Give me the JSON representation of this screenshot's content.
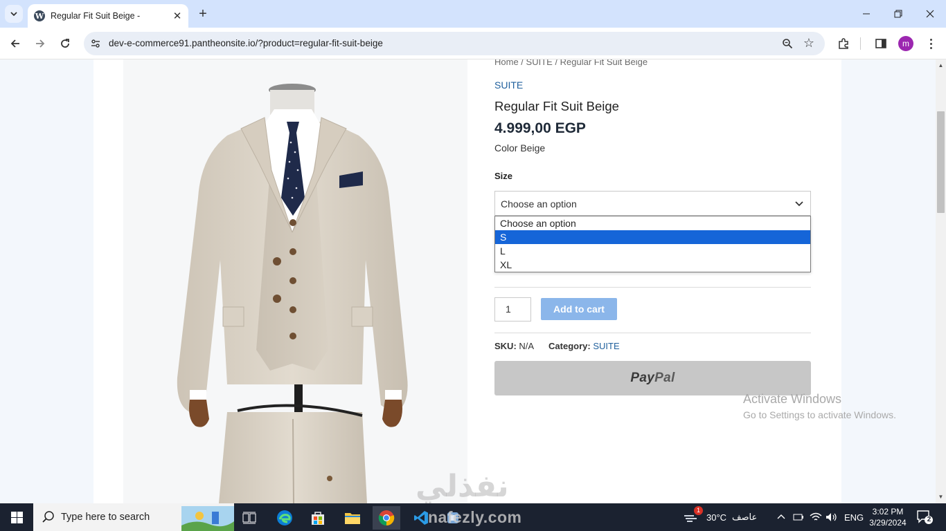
{
  "browser": {
    "tab_title": "Regular Fit Suit Beige -",
    "url": "dev-e-commerce91.pantheonsite.io/?product=regular-fit-suit-beige",
    "profile_initial": "m"
  },
  "product": {
    "breadcrumb": {
      "home": "Home",
      "sep1": " / ",
      "category": "SUITE",
      "sep2": " / ",
      "current": "Regular Fit Suit Beige"
    },
    "category_link": "SUITE",
    "title": "Regular Fit Suit Beige",
    "price": "4.999,00 EGP",
    "color_line": "Color Beige",
    "size_label": "Size",
    "size_select": {
      "value": "Choose an option",
      "options": [
        {
          "label": "Choose an option",
          "selected": false
        },
        {
          "label": "S",
          "selected": true
        },
        {
          "label": "L",
          "selected": false
        },
        {
          "label": "XL",
          "selected": false
        }
      ]
    },
    "quantity": "1",
    "add_to_cart": "Add to cart",
    "sku_label": "SKU:",
    "sku_value": "N/A",
    "category_label": "Category:",
    "category_value": "SUITE",
    "paypal": {
      "pay": "Pay",
      "pal": "Pal"
    }
  },
  "overlays": {
    "activate_title": "Activate Windows",
    "activate_sub": "Go to Settings to activate Windows.",
    "watermark_ar": "نفذلي",
    "watermark_en": "nafezly.com"
  },
  "taskbar": {
    "search_placeholder": "Type here to search",
    "weather_temp": "30°C",
    "weather_text": "عاصف",
    "weather_badge": "1",
    "language": "ENG",
    "time": "3:02 PM",
    "date": "3/29/2024",
    "notifications": "2"
  },
  "colors": {
    "link_blue": "#1f5f9c",
    "selected_option": "#1565d8",
    "add_to_cart": "#8bb6ea",
    "paypal_button": "#c7c7c7",
    "taskbar": "#1b2230",
    "tabbar": "#d3e3fd"
  }
}
